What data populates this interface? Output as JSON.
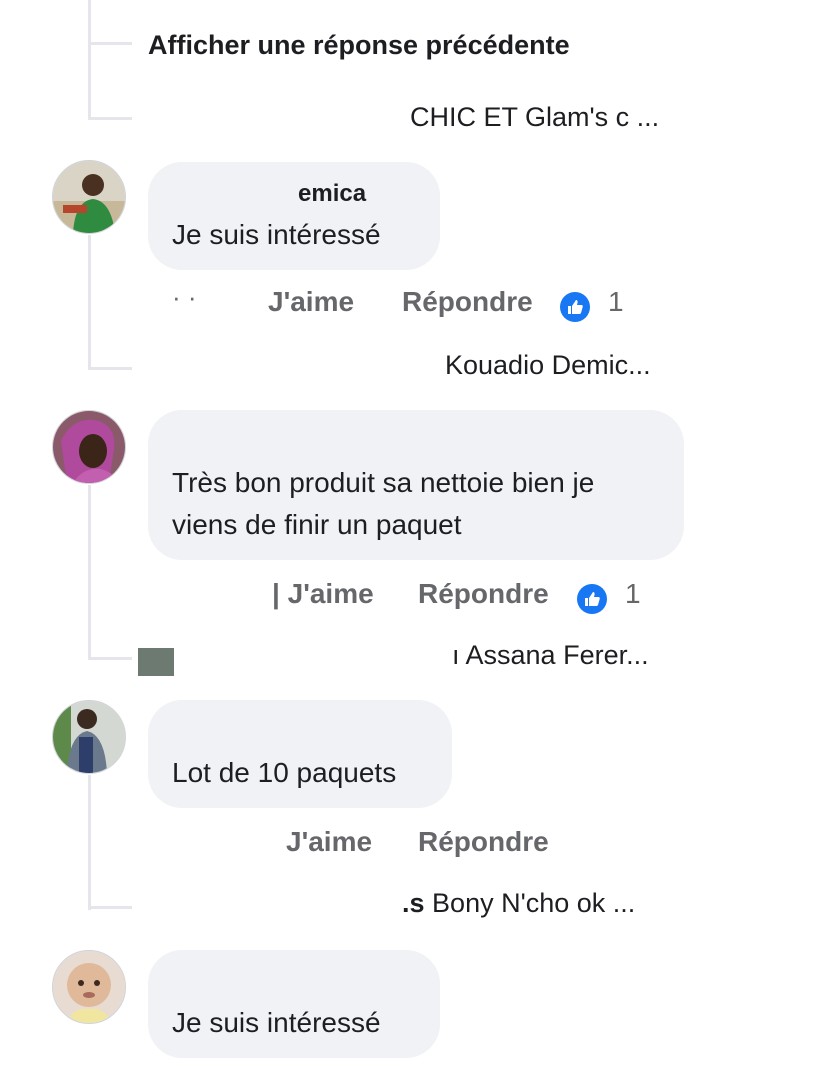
{
  "thread": {
    "view_previous": "Afficher une réponse précédente",
    "first_preview": "CHIC ET Glam's c ..."
  },
  "comments": [
    {
      "author": "emica",
      "text": "Je suis intéressé",
      "like_label": "J'aime",
      "reply_label": "Répondre",
      "reaction_count": "1",
      "reply_preview": "Kouadio Demic..."
    },
    {
      "text_line1": "Très bon produit sa nettoie bien je",
      "text_line2": "viens de finir un paquet",
      "like_label": "J'aime",
      "reply_label": "Répondre",
      "reaction_count": "1",
      "reply_preview": "Assana Ferer..."
    },
    {
      "text": "Lot de 10 paquets",
      "like_label": "J'aime",
      "reply_label": "Répondre",
      "reply_preview_prefix": ".s",
      "reply_preview": "Bony N'cho ok ..."
    },
    {
      "text": "Je suis intéressé"
    }
  ],
  "icons": {
    "like": "thumbs-up-icon",
    "like_color": "#1877f2"
  }
}
